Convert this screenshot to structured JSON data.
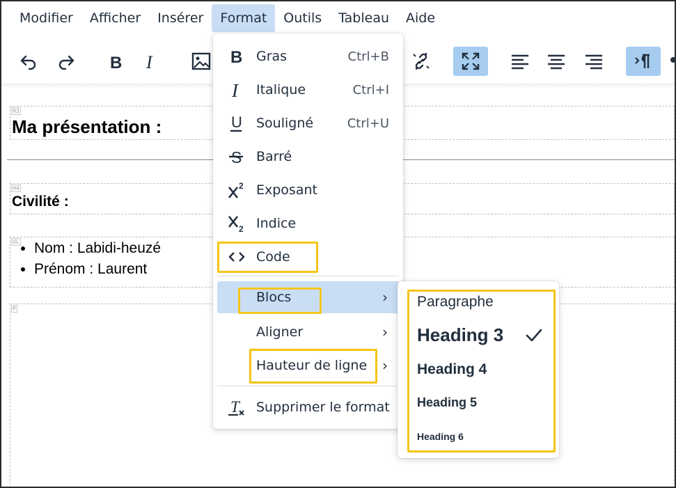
{
  "menubar": {
    "items": [
      {
        "label": "Modifier"
      },
      {
        "label": "Afficher"
      },
      {
        "label": "Insérer"
      },
      {
        "label": "Format",
        "active": true
      },
      {
        "label": "Outils"
      },
      {
        "label": "Tableau"
      },
      {
        "label": "Aide"
      }
    ]
  },
  "toolbar": {
    "buttons": [
      {
        "icon": "undo-icon"
      },
      {
        "icon": "redo-icon"
      },
      {
        "icon": "bold-icon"
      },
      {
        "icon": "italic-icon"
      },
      {
        "icon": "image-icon"
      },
      {
        "icon": "unlink-icon"
      },
      {
        "icon": "fullscreen-icon",
        "active": true
      },
      {
        "icon": "align-left-icon"
      },
      {
        "icon": "align-center-icon"
      },
      {
        "icon": "align-right-icon"
      },
      {
        "icon": "ltr-direction-icon",
        "active": true
      }
    ]
  },
  "document": {
    "h3_tag": "H3",
    "title": "Ma présentation :",
    "h4_tag": "H4",
    "civility": "Civilité :",
    "ul_tag": "UL",
    "list": [
      "Nom : Labidi-heuzé",
      "Prénom : Laurent"
    ],
    "p_tag": "P"
  },
  "format_menu": {
    "items": [
      {
        "icon": "bold-icon",
        "label": "Gras",
        "shortcut": "Ctrl+B"
      },
      {
        "icon": "italic-icon",
        "label": "Italique",
        "shortcut": "Ctrl+I"
      },
      {
        "icon": "underline-icon",
        "label": "Souligné",
        "shortcut": "Ctrl+U"
      },
      {
        "icon": "strikethrough-icon",
        "label": "Barré"
      },
      {
        "icon": "superscript-icon",
        "label": "Exposant"
      },
      {
        "icon": "subscript-icon",
        "label": "Indice"
      },
      {
        "icon": "code-icon",
        "label": "Code"
      },
      {
        "label": "Blocs",
        "submenu": true,
        "hover": true
      },
      {
        "label": "Aligner",
        "submenu": true
      },
      {
        "label": "Hauteur de ligne",
        "submenu": true
      },
      {
        "icon": "remove-format-icon",
        "label": "Supprimer le format"
      }
    ]
  },
  "blocks_submenu": {
    "items": [
      {
        "label": "Paragraphe"
      },
      {
        "label": "Heading 3",
        "checked": true
      },
      {
        "label": "Heading 4"
      },
      {
        "label": "Heading 5"
      },
      {
        "label": "Heading 6"
      }
    ]
  },
  "colors": {
    "menu_active_bg": "#c9def5",
    "toolbar_active_bg": "#a6cdf0",
    "highlight": "#f5c518",
    "text": "#222f3e"
  }
}
